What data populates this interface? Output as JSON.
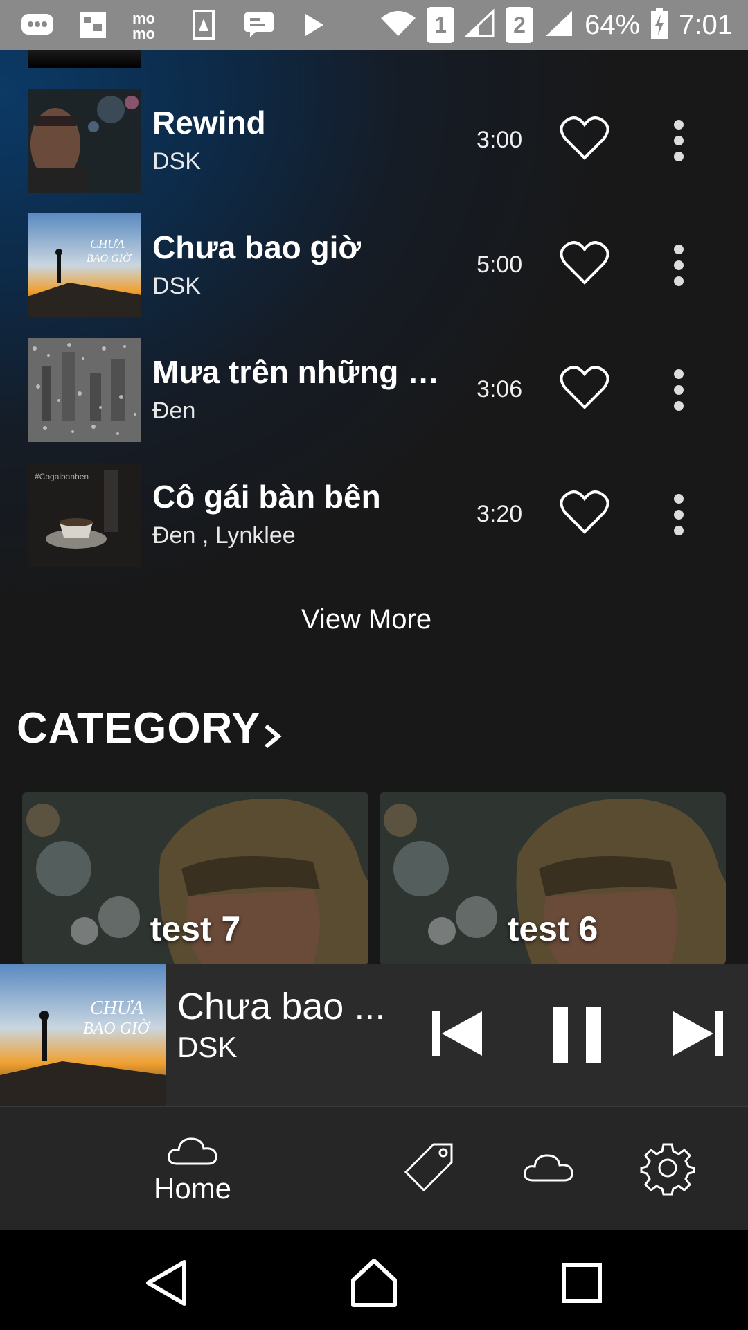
{
  "status_bar": {
    "battery": "64%",
    "time": "7:01",
    "sim1": "1",
    "sim2": "2",
    "left_icons": [
      "chat-bubble-icon",
      "app-icon",
      "momo-icon",
      "file-icon",
      "message-icon",
      "play-store-icon"
    ],
    "momo_text": "mo\nmo"
  },
  "songs": [
    {
      "title": "Rewind",
      "artist": "DSK",
      "duration": "3:00"
    },
    {
      "title": "Chưa bao giờ",
      "artist": "DSK",
      "duration": "5:00"
    },
    {
      "title": "Mưa trên những m...",
      "artist": "Đen",
      "duration": "3:06"
    },
    {
      "title": "Cô gái bàn bên",
      "artist": "Đen , Lynklee",
      "duration": "3:20"
    }
  ],
  "view_more": "View More",
  "category": {
    "title": "CATEGORY",
    "items": [
      {
        "label": "test 7"
      },
      {
        "label": "test 6"
      }
    ]
  },
  "player": {
    "title": "Chưa bao ...",
    "artist": "DSK"
  },
  "bottom_nav": {
    "home_label": "Home",
    "icons": [
      "cloud-icon",
      "tag-icon",
      "cloud-icon",
      "gear-icon"
    ]
  },
  "colors": {
    "background": "#181818",
    "accent_blue": "#0b3a66",
    "player_bg": "#2b2b2b",
    "nav_bg": "#262626"
  }
}
